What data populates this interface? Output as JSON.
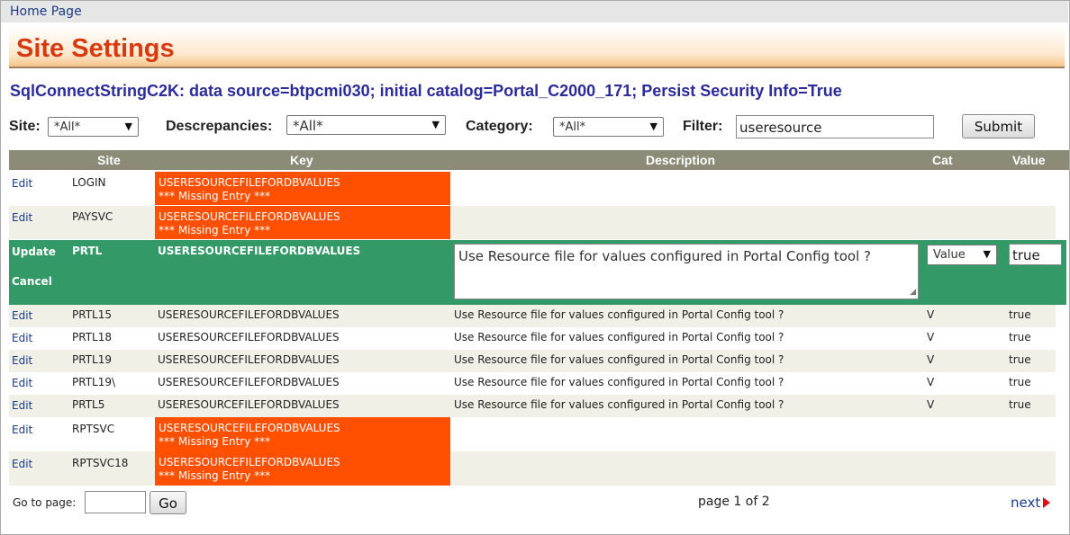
{
  "nav": {
    "home": "Home Page"
  },
  "page_title": "Site Settings",
  "connection": "SqlConnectStringC2K: data source=btpcmi030; initial catalog=Portal_C2000_171; Persist Security Info=True",
  "filters": {
    "site_label": "Site:",
    "site_value": "*All*",
    "disc_label": "Descrepancies:",
    "disc_value": "*All*",
    "cat_label": "Category:",
    "cat_value": "*All*",
    "filter_label": "Filter:",
    "filter_value": "useresource",
    "submit": "Submit"
  },
  "table": {
    "headers": {
      "site": "Site",
      "key": "Key",
      "description": "Description",
      "cat": "Cat",
      "value": "Value"
    },
    "rows": [
      {
        "action": "Edit",
        "site": "LOGIN",
        "key": "USERESOURCEFILEFORDBVALUES",
        "missing": "*** Missing Entry ***"
      },
      {
        "action": "Edit",
        "site": "PAYSVC",
        "key": "USERESOURCEFILEFORDBVALUES",
        "missing": "*** Missing Entry ***"
      },
      {
        "update": "Update",
        "cancel": "Cancel",
        "site": "PRTL",
        "key": "USERESOURCEFILEFORDBVALUES",
        "description": "Use Resource file for values configured in Portal Config tool ?",
        "cat": "Value",
        "value": "true"
      },
      {
        "action": "Edit",
        "site": "PRTL15",
        "key": "USERESOURCEFILEFORDBVALUES",
        "description": "Use Resource file for values configured in Portal Config tool ?",
        "cat": "V",
        "value": "true"
      },
      {
        "action": "Edit",
        "site": "PRTL18",
        "key": "USERESOURCEFILEFORDBVALUES",
        "description": "Use Resource file for values configured in Portal Config tool ?",
        "cat": "V",
        "value": "true"
      },
      {
        "action": "Edit",
        "site": "PRTL19",
        "key": "USERESOURCEFILEFORDBVALUES",
        "description": "Use Resource file for values configured in Portal Config tool ?",
        "cat": "V",
        "value": "true"
      },
      {
        "action": "Edit",
        "site": "PRTL19\\",
        "key": "USERESOURCEFILEFORDBVALUES",
        "description": "Use Resource file for values configured in Portal Config tool ?",
        "cat": "V",
        "value": "true"
      },
      {
        "action": "Edit",
        "site": "PRTL5",
        "key": "USERESOURCEFILEFORDBVALUES",
        "description": "Use Resource file for values configured in Portal Config tool ?",
        "cat": "V",
        "value": "true"
      },
      {
        "action": "Edit",
        "site": "RPTSVC",
        "key": "USERESOURCEFILEFORDBVALUES",
        "missing": "*** Missing Entry ***"
      },
      {
        "action": "Edit",
        "site": "RPTSVC18",
        "key": "USERESOURCEFILEFORDBVALUES",
        "missing": "*** Missing Entry ***"
      }
    ]
  },
  "pager": {
    "goto_label": "Go to page:",
    "goto_value": "",
    "go": "Go",
    "info": "page 1 of 2",
    "next": "next"
  },
  "colors": {
    "accent_title": "#d83a10",
    "missing_bg": "#ff4f00",
    "edit_row_bg": "#339966",
    "header_bg": "#8b8b78"
  }
}
